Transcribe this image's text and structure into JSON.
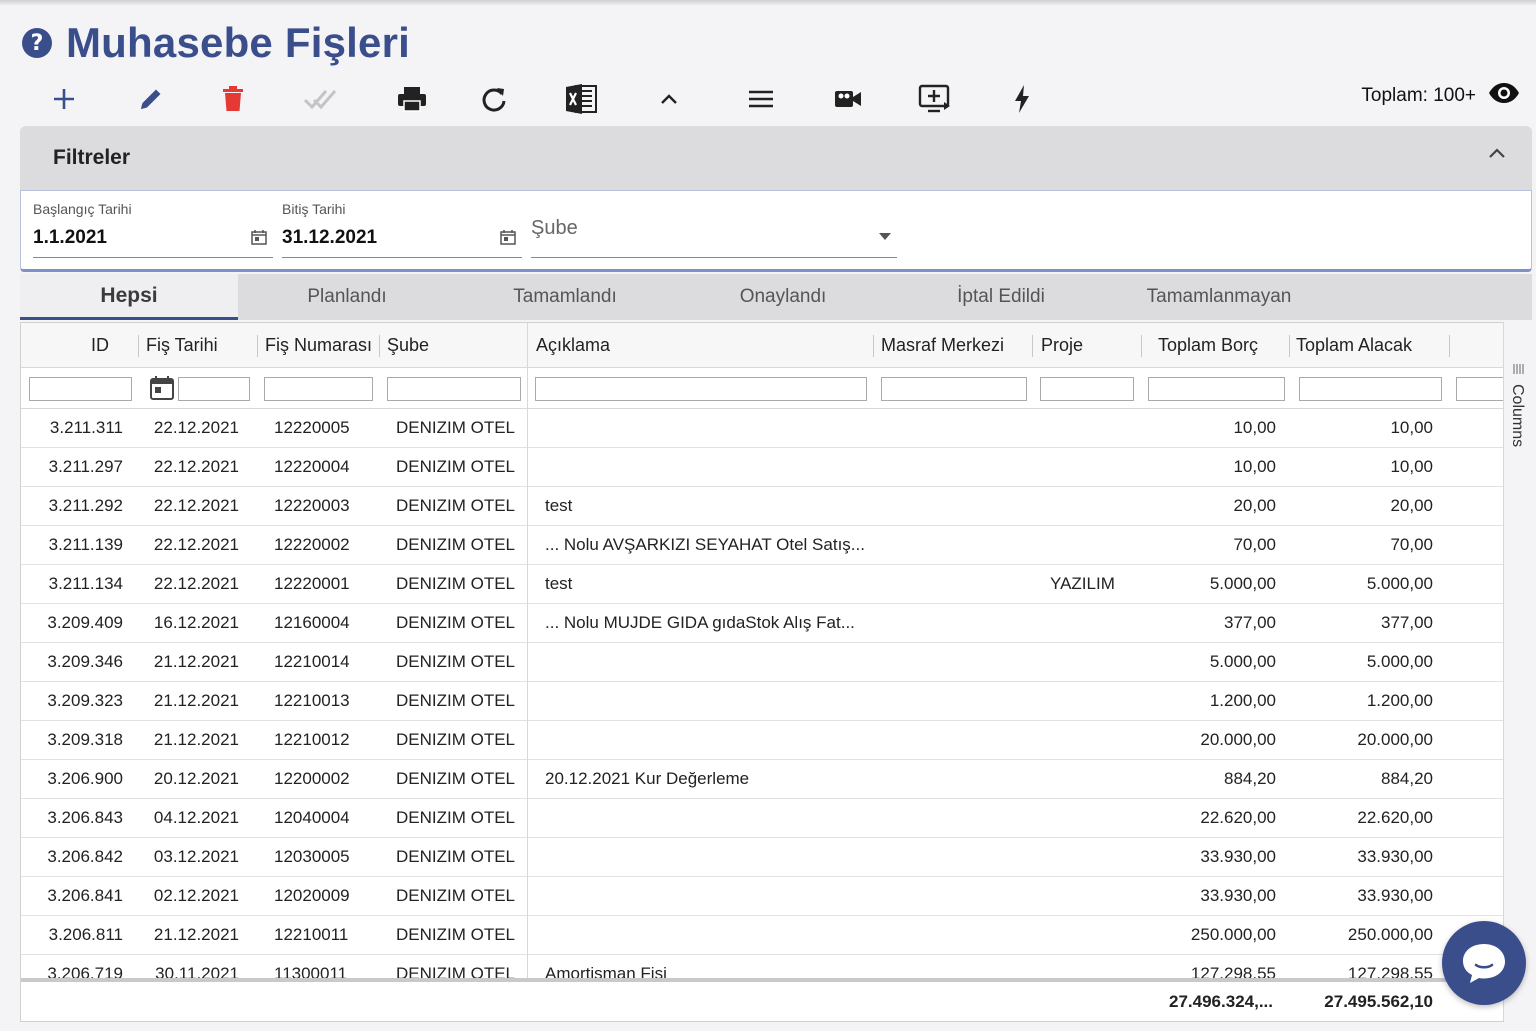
{
  "page": {
    "title": "Muhasebe Fişleri"
  },
  "toolbar": {
    "items": [
      {
        "name": "add-icon"
      },
      {
        "name": "edit-icon"
      },
      {
        "name": "delete-icon"
      },
      {
        "name": "approve-icon"
      },
      {
        "name": "print-icon"
      },
      {
        "name": "refresh-icon"
      },
      {
        "name": "excel-icon"
      },
      {
        "name": "collapse-icon"
      },
      {
        "name": "menu-icon"
      },
      {
        "name": "video-icon"
      },
      {
        "name": "add-screen-icon"
      },
      {
        "name": "flash-icon"
      }
    ],
    "total_label": "Toplam: 100+"
  },
  "colors": {
    "accent": "#3b4e8c",
    "delete": "#e53935",
    "disabled": "#c4c4c4"
  },
  "filters": {
    "title": "Filtreler",
    "start_label": "Başlangıç Tarihi",
    "start_value": "1.1.2021",
    "end_label": "Bitiş Tarihi",
    "end_value": "31.12.2021",
    "branch_placeholder": "Şube"
  },
  "tabs": [
    "Hepsi",
    "Planlandı",
    "Tamamlandı",
    "Onaylandı",
    "İptal Edildi",
    "Tamamlanmayan"
  ],
  "active_tab": "Hepsi",
  "grid": {
    "columns": [
      "ID",
      "Fiş Tarihi",
      "Fiş Numarası",
      "Şube",
      "Açıklama",
      "Masraf Merkezi",
      "Proje",
      "Toplam Borç",
      "Toplam Alacak"
    ],
    "rows": [
      [
        "3.211.311",
        "22.12.2021",
        "12220005",
        "DENIZIM OTEL",
        "",
        "",
        "",
        "10,00",
        "10,00"
      ],
      [
        "3.211.297",
        "22.12.2021",
        "12220004",
        "DENIZIM OTEL",
        "",
        "",
        "",
        "10,00",
        "10,00"
      ],
      [
        "3.211.292",
        "22.12.2021",
        "12220003",
        "DENIZIM OTEL",
        "test",
        "",
        "",
        "20,00",
        "20,00"
      ],
      [
        "3.211.139",
        "22.12.2021",
        "12220002",
        "DENIZIM OTEL",
        "... Nolu AVŞARKIZI SEYAHAT Otel Satış...",
        "",
        "",
        "70,00",
        "70,00"
      ],
      [
        "3.211.134",
        "22.12.2021",
        "12220001",
        "DENIZIM OTEL",
        "test",
        "",
        "YAZILIM",
        "5.000,00",
        "5.000,00"
      ],
      [
        "3.209.409",
        "16.12.2021",
        "12160004",
        "DENIZIM OTEL",
        "... Nolu MUJDE GIDA gıdaStok Alış Fat...",
        "",
        "",
        "377,00",
        "377,00"
      ],
      [
        "3.209.346",
        "21.12.2021",
        "12210014",
        "DENIZIM OTEL",
        "",
        "",
        "",
        "5.000,00",
        "5.000,00"
      ],
      [
        "3.209.323",
        "21.12.2021",
        "12210013",
        "DENIZIM OTEL",
        "",
        "",
        "",
        "1.200,00",
        "1.200,00"
      ],
      [
        "3.209.318",
        "21.12.2021",
        "12210012",
        "DENIZIM OTEL",
        "",
        "",
        "",
        "20.000,00",
        "20.000,00"
      ],
      [
        "3.206.900",
        "20.12.2021",
        "12200002",
        "DENIZIM OTEL",
        "20.12.2021 Kur Değerleme",
        "",
        "",
        "884,20",
        "884,20"
      ],
      [
        "3.206.843",
        "04.12.2021",
        "12040004",
        "DENIZIM OTEL",
        "",
        "",
        "",
        "22.620,00",
        "22.620,00"
      ],
      [
        "3.206.842",
        "03.12.2021",
        "12030005",
        "DENIZIM OTEL",
        "",
        "",
        "",
        "33.930,00",
        "33.930,00"
      ],
      [
        "3.206.841",
        "02.12.2021",
        "12020009",
        "DENIZIM OTEL",
        "",
        "",
        "",
        "33.930,00",
        "33.930,00"
      ],
      [
        "3.206.811",
        "21.12.2021",
        "12210011",
        "DENIZIM OTEL",
        "",
        "",
        "",
        "250.000,00",
        "250.000,00"
      ],
      [
        "3.206.719",
        "30.11.2021",
        "11300011",
        "DENIZIM OTEL",
        "Amortisman Fişi",
        "",
        "",
        "127.298,55",
        "127.298,55"
      ]
    ],
    "totals": {
      "debit": "27.496.324,...",
      "credit": "27.495.562,10"
    }
  },
  "side_panel": {
    "label": "Columns"
  }
}
